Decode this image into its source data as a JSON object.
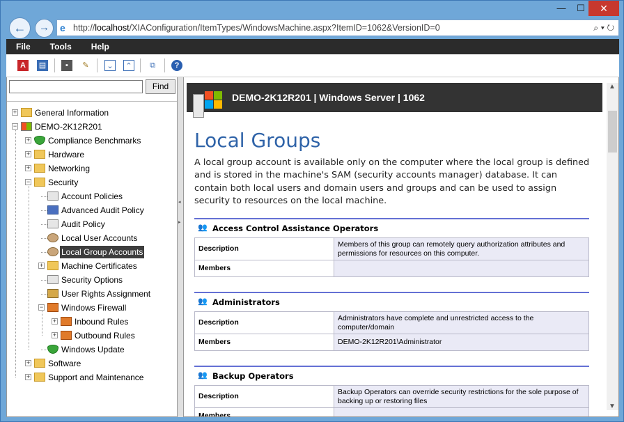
{
  "window": {
    "minimize": "—",
    "maximize": "☐",
    "close": "✕"
  },
  "browser": {
    "back": "←",
    "forward": "→",
    "url_prefix": "http://",
    "url_host": "localhost",
    "url_path": "/XIAConfiguration/ItemTypes/WindowsMachine.aspx?ItemID=1062&VersionID=0",
    "url_tools": "⌕ ▾ ↻"
  },
  "menu": [
    "File",
    "Tools",
    "Help"
  ],
  "toolbar_icons": [
    "pdf-icon",
    "export-icon",
    "save-icon",
    "edit-icon",
    "expand-all-icon",
    "collapse-all-icon",
    "compare-icon",
    "help-icon"
  ],
  "search": {
    "placeholder": "",
    "find_label": "Find"
  },
  "tree": [
    {
      "label": "General Information",
      "depth": 0,
      "expander": "+",
      "icon": "folder"
    },
    {
      "label": "DEMO-2K12R201",
      "depth": 0,
      "expander": "−",
      "icon": "server"
    },
    {
      "label": "Compliance Benchmarks",
      "depth": 1,
      "expander": "+",
      "icon": "shield"
    },
    {
      "label": "Hardware",
      "depth": 1,
      "expander": "+",
      "icon": "folder"
    },
    {
      "label": "Networking",
      "depth": 1,
      "expander": "+",
      "icon": "folder"
    },
    {
      "label": "Security",
      "depth": 1,
      "expander": "−",
      "icon": "folder"
    },
    {
      "label": "Account Policies",
      "depth": 2,
      "expander": "",
      "icon": "policy"
    },
    {
      "label": "Advanced Audit Policy",
      "depth": 2,
      "expander": "",
      "icon": "audit"
    },
    {
      "label": "Audit Policy",
      "depth": 2,
      "expander": "",
      "icon": "policy"
    },
    {
      "label": "Local User Accounts",
      "depth": 2,
      "expander": "",
      "icon": "users"
    },
    {
      "label": "Local Group Accounts",
      "depth": 2,
      "expander": "",
      "icon": "users",
      "selected": true
    },
    {
      "label": "Machine Certificates",
      "depth": 2,
      "expander": "+",
      "icon": "folder"
    },
    {
      "label": "Security Options",
      "depth": 2,
      "expander": "",
      "icon": "policy"
    },
    {
      "label": "User Rights Assignment",
      "depth": 2,
      "expander": "",
      "icon": "rights"
    },
    {
      "label": "Windows Firewall",
      "depth": 2,
      "expander": "−",
      "icon": "firewall"
    },
    {
      "label": "Inbound Rules",
      "depth": 3,
      "expander": "+",
      "icon": "firewall"
    },
    {
      "label": "Outbound Rules",
      "depth": 3,
      "expander": "+",
      "icon": "firewall"
    },
    {
      "label": "Windows Update",
      "depth": 2,
      "expander": "",
      "icon": "shield"
    },
    {
      "label": "Software",
      "depth": 1,
      "expander": "+",
      "icon": "folder"
    },
    {
      "label": "Support and Maintenance",
      "depth": 1,
      "expander": "+",
      "icon": "folder"
    }
  ],
  "content": {
    "header": "DEMO-2K12R201 | Windows Server | 1062",
    "title": "Local Groups",
    "intro": "A local group account is available only on the computer where the local group is defined and is stored in the machine's SAM (security accounts manager) database. It can contain both local users and domain users and groups and can be used to assign security to resources on the local machine.",
    "groups": [
      {
        "name": "Access Control Assistance Operators",
        "description": "Members of this group can remotely query authorization attributes and permissions for resources on this computer.",
        "members": ""
      },
      {
        "name": "Administrators",
        "description": "Administrators have complete and unrestricted access to the computer/domain",
        "members": "DEMO-2K12R201\\Administrator"
      },
      {
        "name": "Backup Operators",
        "description": "Backup Operators can override security restrictions for the sole purpose of backing up or restoring files",
        "members": ""
      }
    ],
    "description_label": "Description",
    "members_label": "Members"
  },
  "colors": {
    "accent": "#2f63a8",
    "menubar": "#2b2b2b",
    "selected": "#3d3d3d",
    "close": "#c7382e"
  }
}
